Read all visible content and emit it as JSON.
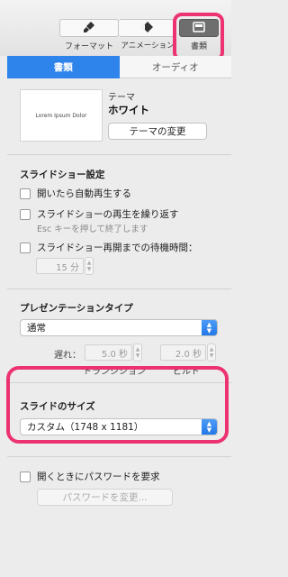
{
  "toolbar": {
    "format_label": "フォーマット",
    "animate_label": "アニメーション",
    "document_label": "書類"
  },
  "tabs": {
    "document": "書類",
    "audio": "オーディオ"
  },
  "theme": {
    "thumbnail_text": "Lorem Ipsum Dolor",
    "label": "テーマ",
    "name": "ホワイト",
    "change_button": "テーマの変更"
  },
  "slideshow": {
    "title": "スライドショー設定",
    "autoplay": "開いたら自動再生する",
    "loop": "スライドショーの再生を繰り返す",
    "esc_hint": "Esc キーを押して終了します",
    "restart_idle": "スライドショー再開までの待機時間：",
    "idle_value": "15 分"
  },
  "presentation_type": {
    "title": "プレゼンテーションタイプ",
    "value": "通常",
    "delay_label": "遅れ：",
    "transition_value": "5.0 秒",
    "transition_label": "トランジション",
    "build_value": "2.0 秒",
    "build_label": "ビルド"
  },
  "slide_size": {
    "title": "スライドのサイズ",
    "value": "カスタム（1748 x 1181）"
  },
  "password": {
    "require_label": "開くときにパスワードを要求",
    "change_button": "パスワードを変更..."
  },
  "colors": {
    "accent_blue": "#2f84ec",
    "highlight_pink": "#ec3272"
  }
}
